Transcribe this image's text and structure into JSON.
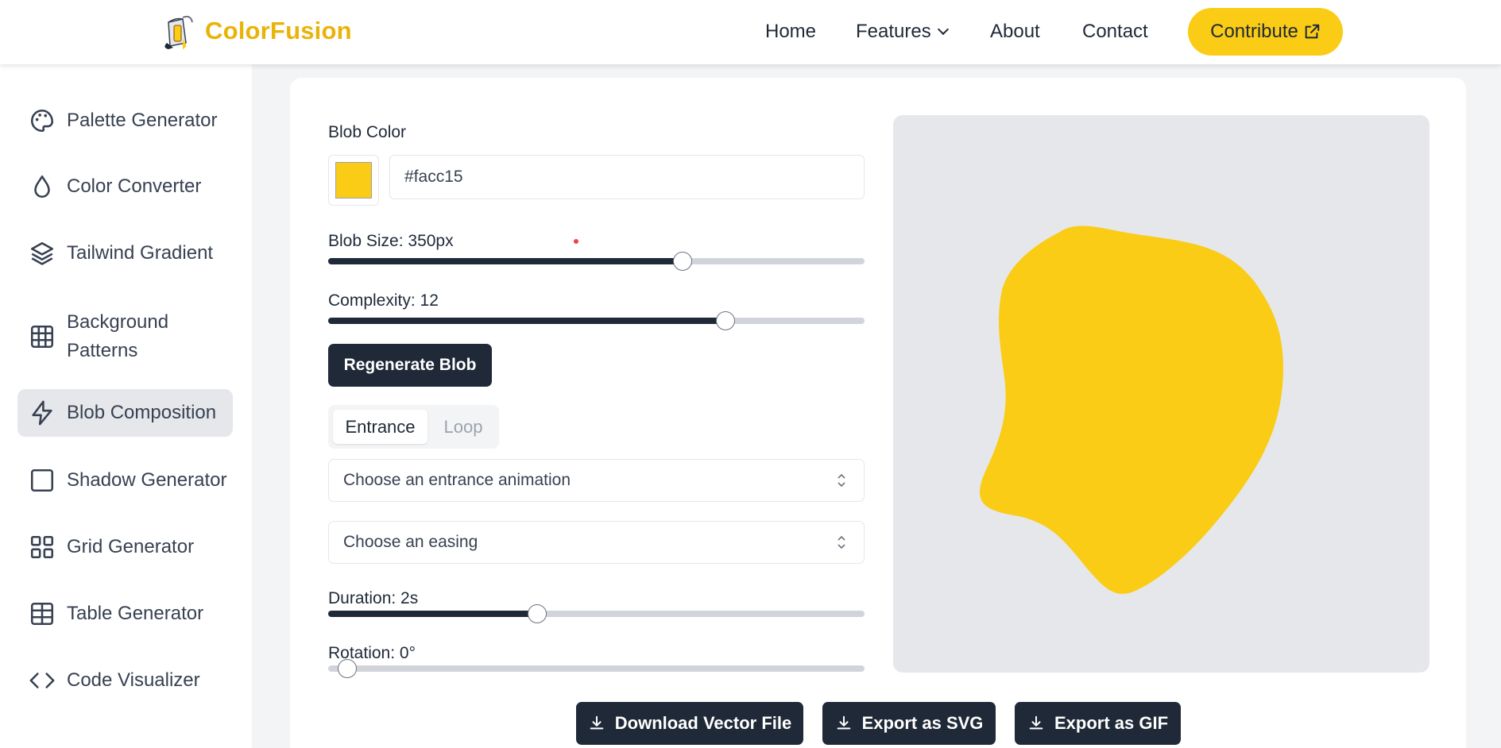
{
  "app": {
    "name": "ColorFusion",
    "accent_color": "#facc15",
    "dark_color": "#1f2937"
  },
  "nav": {
    "home": "Home",
    "features": "Features",
    "about": "About",
    "contact": "Contact",
    "contribute": "Contribute"
  },
  "sidebar": {
    "items": [
      {
        "label": "Palette Generator",
        "icon": "palette-icon"
      },
      {
        "label": "Color Converter",
        "icon": "droplet-icon"
      },
      {
        "label": "Tailwind Gradient",
        "icon": "layers-icon"
      },
      {
        "label": "Background Patterns",
        "icon": "grid-icon"
      },
      {
        "label": "Blob Composition",
        "icon": "zap-icon",
        "active": true
      },
      {
        "label": "Shadow Generator",
        "icon": "square-icon"
      },
      {
        "label": "Grid Generator",
        "icon": "layout-grid-icon"
      },
      {
        "label": "Table Generator",
        "icon": "table-icon"
      },
      {
        "label": "Code Visualizer",
        "icon": "code-icon"
      }
    ]
  },
  "controls": {
    "blob_color_label": "Blob Color",
    "blob_color_value": "#facc15",
    "blob_size_label": "Blob Size: 350px",
    "blob_size_fraction": 0.66,
    "complexity_label": "Complexity: 12",
    "complexity_fraction": 0.74,
    "regenerate_label": "Regenerate Blob",
    "tabs": [
      "Entrance",
      "Loop"
    ],
    "active_tab": "Entrance",
    "entrance_placeholder": "Choose an entrance animation",
    "easing_placeholder": "Choose an easing",
    "duration_label": "Duration: 2s",
    "duration_fraction": 0.39,
    "rotation_label": "Rotation: 0°",
    "rotation_fraction": 0.0
  },
  "preview": {
    "background_color": "#e5e7eb",
    "blob_color": "#facc15"
  },
  "actions": {
    "download_vector": "Download Vector File",
    "export_svg": "Export as SVG",
    "export_gif": "Export as GIF"
  }
}
